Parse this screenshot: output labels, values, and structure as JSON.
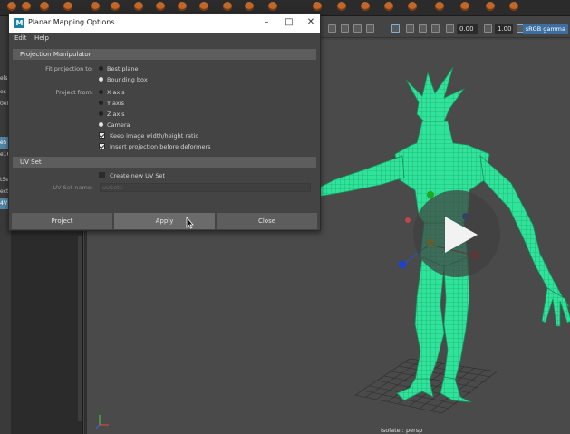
{
  "dialog": {
    "title": "Planar Mapping Options",
    "menu": [
      "Edit",
      "Help"
    ],
    "section_projection": "Projection Manipulator",
    "fit_projection_label": "Fit projection to:",
    "fit_options": [
      {
        "label": "Best plane",
        "selected": false
      },
      {
        "label": "Bounding box",
        "selected": true
      }
    ],
    "project_from_label": "Project from:",
    "project_from_options": [
      {
        "label": "X axis",
        "selected": false
      },
      {
        "label": "Y axis",
        "selected": false
      },
      {
        "label": "Z axis",
        "selected": false
      },
      {
        "label": "Camera",
        "selected": true
      }
    ],
    "checkboxes": [
      {
        "label": "Keep image width/height ratio",
        "checked": true
      },
      {
        "label": "Insert projection before deformers",
        "checked": true
      }
    ],
    "section_uvset": "UV Set",
    "create_uvset_label": "Create new UV Set",
    "create_uvset_checked": false,
    "uvset_name_label": "UV Set name:",
    "uvset_name_value": "uvSet1",
    "buttons": {
      "project": "Project",
      "apply": "Apply",
      "close": "Close"
    }
  },
  "viewport": {
    "field_value_1": "0.00",
    "field_value_2": "1.00",
    "colorspace": "sRGB gamma",
    "camera_label": "Isolate : persp"
  },
  "left_strip": [
    "els",
    "es",
    "0el",
    "e5",
    "e16",
    "tSe",
    "ect",
    "4V"
  ],
  "colors": {
    "mesh": "#2fe39a",
    "accent": "#5285a6",
    "maya_logo": "#1c7fa8"
  }
}
